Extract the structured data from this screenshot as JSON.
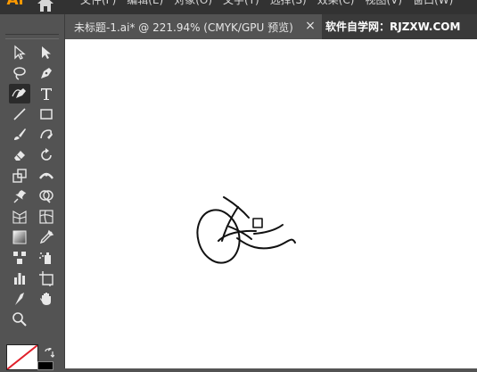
{
  "app": {
    "logo": "Ai"
  },
  "menubar": {
    "items": [
      "文件(F)",
      "编辑(E)",
      "对象(O)",
      "文字(T)",
      "选择(S)",
      "效果(C)",
      "视图(V)",
      "窗口(W)"
    ]
  },
  "document": {
    "tab_title": "未标题-1.ai* @ 221.94% (CMYK/GPU 预览)",
    "close_label": "×"
  },
  "watermark": "软件自学网：RJZXW.COM",
  "tools": [
    {
      "name": "selection-tool"
    },
    {
      "name": "direct-selection-tool"
    },
    {
      "name": "magic-wand-tool"
    },
    {
      "name": "pen-tool"
    },
    {
      "name": "curvature-tool"
    },
    {
      "name": "type-tool"
    },
    {
      "name": "line-tool"
    },
    {
      "name": "rectangle-tool"
    },
    {
      "name": "paintbrush-tool"
    },
    {
      "name": "shaper-tool"
    },
    {
      "name": "eraser-tool"
    },
    {
      "name": "rotate-tool"
    },
    {
      "name": "scale-tool"
    },
    {
      "name": "width-tool"
    },
    {
      "name": "puppet-warp-tool"
    },
    {
      "name": "shape-builder-tool"
    },
    {
      "name": "perspective-grid-tool"
    },
    {
      "name": "mesh-tool"
    },
    {
      "name": "gradient-tool"
    },
    {
      "name": "eyedropper-tool"
    },
    {
      "name": "blend-tool"
    },
    {
      "name": "symbol-sprayer-tool"
    },
    {
      "name": "column-graph-tool"
    },
    {
      "name": "artboard-tool"
    },
    {
      "name": "slice-tool"
    },
    {
      "name": "hand-tool"
    },
    {
      "name": "zoom-tool"
    }
  ],
  "active_tool": "curvature-tool",
  "colors": {
    "fill": "none",
    "stroke": "#000000"
  }
}
